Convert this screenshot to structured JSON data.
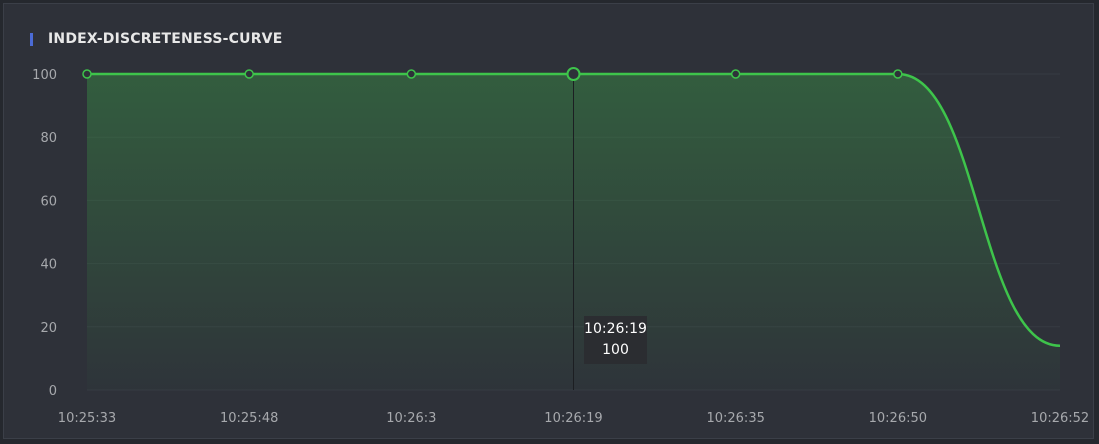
{
  "chart_data": {
    "type": "area",
    "title": "INDEX-DISCRETENESS-CURVE",
    "xlabel": "",
    "ylabel": "",
    "x": [
      "10:25:33",
      "10:25:48",
      "10:26:3",
      "10:26:19",
      "10:26:35",
      "10:26:50",
      "10:26:52"
    ],
    "values": [
      100,
      100,
      100,
      100,
      100,
      100,
      14
    ],
    "ylim": [
      0,
      100
    ],
    "yticks": [
      0,
      20,
      40,
      60,
      80,
      100
    ],
    "grid": true,
    "legend": "none",
    "smooth": true,
    "colors": {
      "line": "#3ec44b",
      "accent": "#4b6bd6",
      "background": "#2e3139"
    },
    "tooltip": {
      "time": "10:26:19",
      "value": "100",
      "index": 3
    }
  }
}
